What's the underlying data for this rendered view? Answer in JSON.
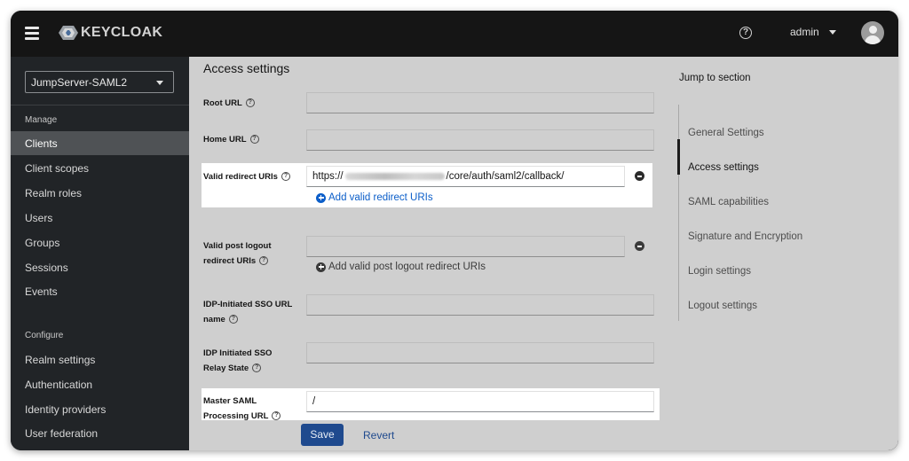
{
  "app": {
    "brand": "KEYCLOAK",
    "user": "admin",
    "colors": {
      "accent": "#1f4a8e",
      "link": "#0b5ec9",
      "header_bg": "#151515",
      "sidebar_bg": "#212427"
    }
  },
  "sidebar": {
    "realm": "JumpServer-SAML2",
    "sections": {
      "manage": "Manage",
      "configure": "Configure"
    },
    "manage_items": [
      {
        "label": "Clients",
        "active": true
      },
      {
        "label": "Client scopes"
      },
      {
        "label": "Realm roles"
      },
      {
        "label": "Users"
      },
      {
        "label": "Groups"
      },
      {
        "label": "Sessions"
      },
      {
        "label": "Events"
      }
    ],
    "configure_items": [
      {
        "label": "Realm settings"
      },
      {
        "label": "Authentication"
      },
      {
        "label": "Identity providers"
      },
      {
        "label": "User federation"
      }
    ]
  },
  "form": {
    "title": "Access settings",
    "root_url": {
      "label": "Root URL",
      "value": ""
    },
    "home_url": {
      "label": "Home URL",
      "value": ""
    },
    "valid_redirect": {
      "label": "Valid redirect URIs",
      "value_prefix": "https://",
      "value_suffix": "/core/auth/saml2/callback/",
      "add_label": "Add valid redirect URIs"
    },
    "post_logout": {
      "label_line1": "Valid post logout",
      "label_line2": "redirect URIs",
      "value": "",
      "add_label": "Add valid post logout redirect URIs"
    },
    "idp_sso_url": {
      "label_line1": "IDP-Initiated SSO URL",
      "label_line2": "name",
      "value": ""
    },
    "idp_relay": {
      "label_line1": "IDP Initiated SSO",
      "label_line2": "Relay State",
      "value": ""
    },
    "master_saml": {
      "label_line1": "Master SAML",
      "label_line2": "Processing URL",
      "value": "/"
    }
  },
  "jump": {
    "title": "Jump to section",
    "items": [
      {
        "label": "General Settings"
      },
      {
        "label": "Access settings",
        "active": true
      },
      {
        "label": "SAML capabilities"
      },
      {
        "label": "Signature and Encryption"
      },
      {
        "label": "Login settings"
      },
      {
        "label": "Logout settings"
      }
    ]
  },
  "footer": {
    "save": "Save",
    "revert": "Revert"
  }
}
